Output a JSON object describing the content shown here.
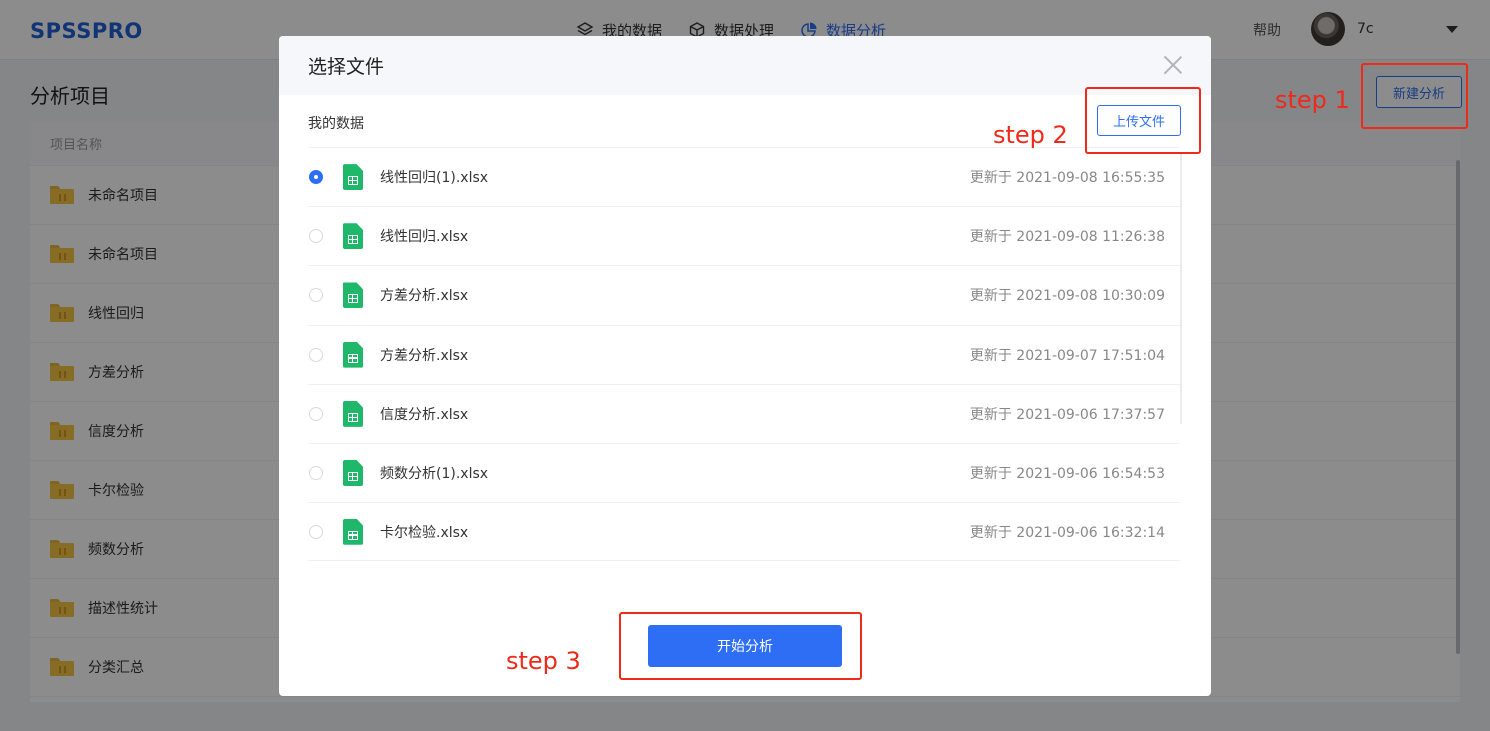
{
  "app": {
    "logo": "SPSSPRO"
  },
  "nav": [
    {
      "label": "我的数据",
      "icon": "layers-icon"
    },
    {
      "label": "数据处理",
      "icon": "cube-icon"
    },
    {
      "label": "数据分析",
      "icon": "pie-chart-icon",
      "active": true
    }
  ],
  "user": {
    "help": "帮助",
    "name": "7c"
  },
  "page": {
    "title": "分析项目",
    "new_button": "新建分析",
    "column_header": "项目名称",
    "projects": [
      "未命名项目",
      "未命名项目",
      "线性回归",
      "方差分析",
      "信度分析",
      "卡尔检验",
      "频数分析",
      "描述性统计",
      "分类汇总"
    ]
  },
  "dialog": {
    "title": "选择文件",
    "section_label": "我的数据",
    "upload_button": "上传文件",
    "start_button": "开始分析",
    "files": [
      {
        "name": "线性回归(1).xlsx",
        "updated": "更新于 2021-09-08 16:55:35",
        "selected": true
      },
      {
        "name": "线性回归.xlsx",
        "updated": "更新于 2021-09-08 11:26:38",
        "selected": false
      },
      {
        "name": "方差分析.xlsx",
        "updated": "更新于 2021-09-08 10:30:09",
        "selected": false
      },
      {
        "name": "方差分析.xlsx",
        "updated": "更新于 2021-09-07 17:51:04",
        "selected": false
      },
      {
        "name": "信度分析.xlsx",
        "updated": "更新于 2021-09-06 17:37:57",
        "selected": false
      },
      {
        "name": "频数分析(1).xlsx",
        "updated": "更新于 2021-09-06 16:54:53",
        "selected": false
      },
      {
        "name": "卡尔检验.xlsx",
        "updated": "更新于 2021-09-06 16:32:14",
        "selected": false
      }
    ]
  },
  "annotations": {
    "step1": "step 1",
    "step2": "step 2",
    "step3": "step 3",
    "color": "#ee2a1b"
  },
  "colors": {
    "accent": "#2e6ef5",
    "logo": "#1f5fd6",
    "file_icon": "#1fb86a",
    "folder": "#f6c546"
  }
}
